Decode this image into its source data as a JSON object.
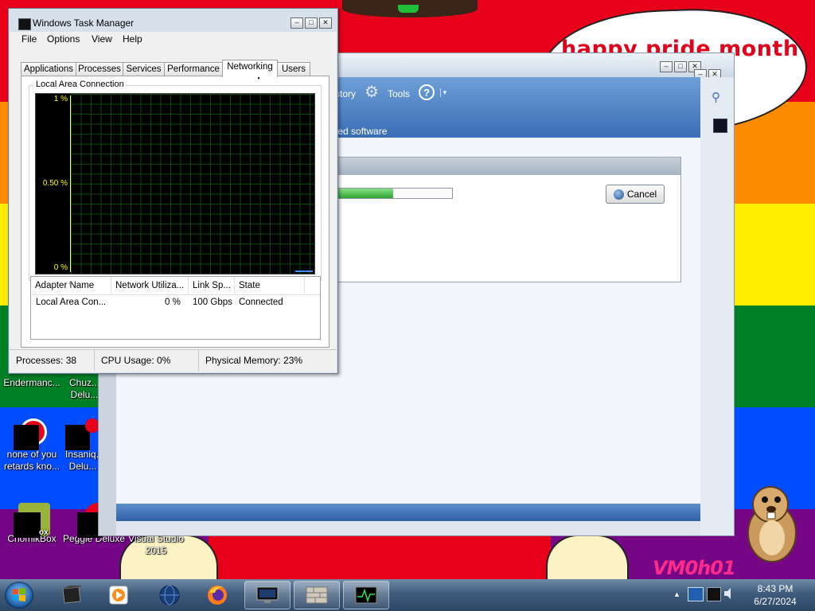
{
  "wallpaper": {
    "banner_text": "happy pride month",
    "signature": "VM0h01",
    "colors": {
      "red": "#e8001a",
      "orange": "#ff8c00",
      "yellow": "#ffed00",
      "green": "#008026",
      "blue": "#004dff",
      "purple": "#750787"
    }
  },
  "desktop_icons": [
    {
      "label": "Endermanc...",
      "icon": "app-icon"
    },
    {
      "label": "Chuz... Delu...",
      "icon": "app-icon"
    },
    {
      "label": "none of you retards kno...",
      "icon": "red-circle-icon"
    },
    {
      "label": "Insaniq... Delu...",
      "icon": "app-icon"
    },
    {
      "label": "ChomikBox",
      "icon": "hamster-icon"
    },
    {
      "label": "Peggle Deluxe",
      "icon": "peggle-icon"
    },
    {
      "label": "Visual Studio 2015",
      "icon": "visual-studio-icon"
    }
  ],
  "installer": {
    "toolbar_history": "story",
    "toolbar_tools": "Tools",
    "help_symbol": "?",
    "blue_caption": "ted software",
    "progress_fraction": 0.51,
    "cancel_label": "Cancel"
  },
  "task_manager": {
    "title": "Windows Task Manager",
    "menu": [
      "File",
      "Options",
      "View",
      "Help"
    ],
    "tabs": [
      "Applications",
      "Processes",
      "Services",
      "Performance",
      "Networking",
      "Users"
    ],
    "active_tab": "Networking",
    "group_label": "Local Area Connection",
    "graph_axis": [
      "1 %",
      "0.50 %",
      "0 %"
    ],
    "table_headers": [
      "Adapter Name",
      "Network Utiliza...",
      "Link Sp...",
      "State"
    ],
    "rows": [
      {
        "adapter": "Local Area Con...",
        "utilization": "0 %",
        "link_speed": "100 Gbps",
        "state": "Connected"
      }
    ],
    "status": {
      "processes": "Processes: 38",
      "cpu": "CPU Usage: 0%",
      "memory": "Physical Memory: 23%"
    }
  },
  "taskbar": {
    "pinned": [
      "terminal-icon",
      "media-player-icon",
      "globe-icon",
      "firefox-icon",
      "remote-desktop-icon",
      "wall-icon",
      "task-manager-icon"
    ],
    "time": "8:43 PM",
    "date": "6/27/2024"
  }
}
